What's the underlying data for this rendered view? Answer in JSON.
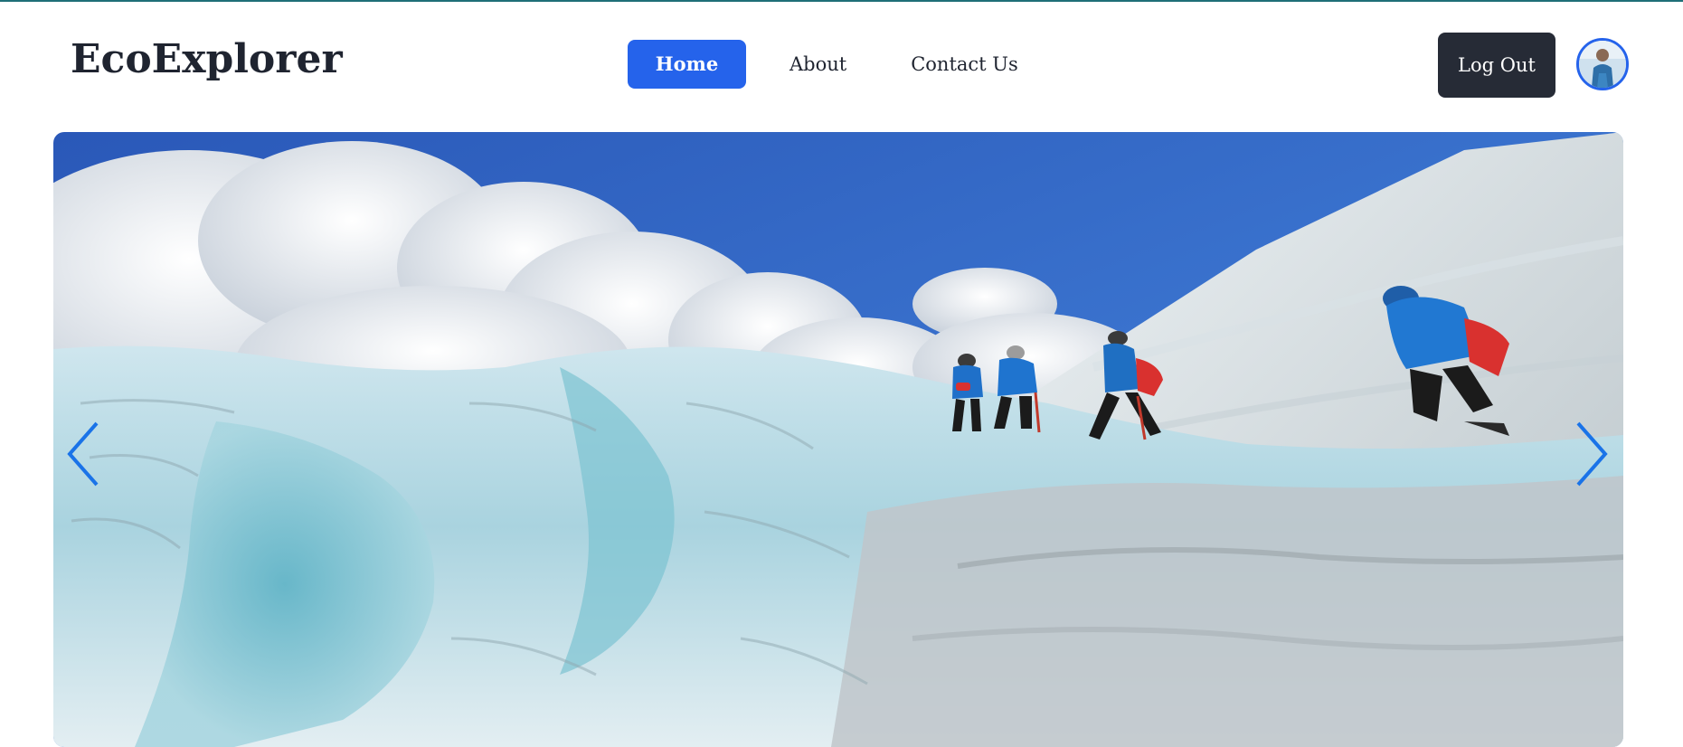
{
  "brand": {
    "name": "EcoExplorer"
  },
  "nav": {
    "items": [
      {
        "label": "Home",
        "active": true
      },
      {
        "label": "About",
        "active": false
      },
      {
        "label": "Contact Us",
        "active": false
      }
    ]
  },
  "header_actions": {
    "logout_label": "Log Out"
  },
  "colors": {
    "accent": "#2563eb",
    "dark_button": "#262b36",
    "brand_text": "#1f2430",
    "top_rule": "#1f6f78"
  },
  "icons": {
    "carousel_prev": "chevron-left-icon",
    "carousel_next": "chevron-right-icon",
    "avatar": "user-avatar"
  }
}
